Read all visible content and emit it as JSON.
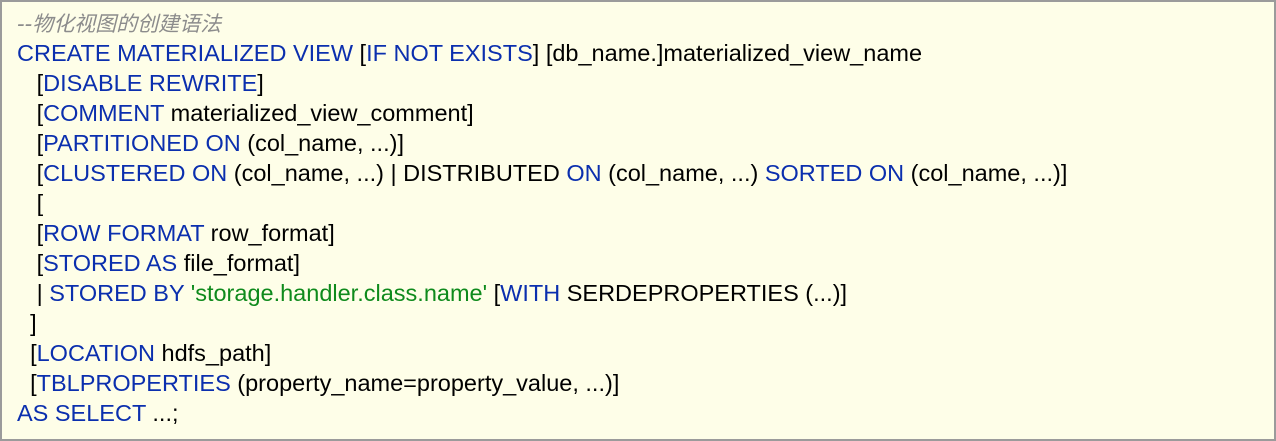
{
  "code_lines": [
    {
      "indent": "",
      "tokens": [
        {
          "t": "--物化视图的创建语法",
          "c": "cmt"
        }
      ]
    },
    {
      "indent": "",
      "tokens": [
        {
          "t": "CREATE MATERIALIZED VIEW ",
          "c": "kw"
        },
        {
          "t": "[",
          "c": "txt"
        },
        {
          "t": "IF NOT EXISTS",
          "c": "kw"
        },
        {
          "t": "] [db_name.]materialized_view_name",
          "c": "txt"
        }
      ]
    },
    {
      "indent": "   ",
      "tokens": [
        {
          "t": "[",
          "c": "txt"
        },
        {
          "t": "DISABLE REWRITE",
          "c": "kw"
        },
        {
          "t": "]",
          "c": "txt"
        }
      ]
    },
    {
      "indent": "   ",
      "tokens": [
        {
          "t": "[",
          "c": "txt"
        },
        {
          "t": "COMMENT",
          "c": "kw"
        },
        {
          "t": " materialized_view_comment]",
          "c": "txt"
        }
      ]
    },
    {
      "indent": "   ",
      "tokens": [
        {
          "t": "[",
          "c": "txt"
        },
        {
          "t": "PARTITIONED ON",
          "c": "kw"
        },
        {
          "t": " (col_name, ...)]",
          "c": "txt"
        }
      ]
    },
    {
      "indent": "   ",
      "tokens": [
        {
          "t": "[",
          "c": "txt"
        },
        {
          "t": "CLUSTERED ON",
          "c": "kw"
        },
        {
          "t": " (col_name, ...) | DISTRIBUTED ",
          "c": "txt"
        },
        {
          "t": "ON",
          "c": "kw"
        },
        {
          "t": " (col_name, ...) ",
          "c": "txt"
        },
        {
          "t": "SORTED ON",
          "c": "kw"
        },
        {
          "t": " (col_name, ...)]",
          "c": "txt"
        }
      ]
    },
    {
      "indent": "   ",
      "tokens": [
        {
          "t": "[",
          "c": "txt"
        }
      ]
    },
    {
      "indent": "   ",
      "tokens": [
        {
          "t": "[",
          "c": "txt"
        },
        {
          "t": "ROW FORMAT",
          "c": "kw"
        },
        {
          "t": " row_format]",
          "c": "txt"
        }
      ]
    },
    {
      "indent": "   ",
      "tokens": [
        {
          "t": "[",
          "c": "txt"
        },
        {
          "t": "STORED AS",
          "c": "kw"
        },
        {
          "t": " file_format]",
          "c": "txt"
        }
      ]
    },
    {
      "indent": "   ",
      "tokens": [
        {
          "t": "| ",
          "c": "txt"
        },
        {
          "t": "STORED BY",
          "c": "kw"
        },
        {
          "t": " ",
          "c": "txt"
        },
        {
          "t": "'storage.handler.class.name'",
          "c": "str"
        },
        {
          "t": " [",
          "c": "txt"
        },
        {
          "t": "WITH",
          "c": "kw"
        },
        {
          "t": " SERDEPROPERTIES (...)]",
          "c": "txt"
        }
      ]
    },
    {
      "indent": "  ",
      "tokens": [
        {
          "t": "]",
          "c": "txt"
        }
      ]
    },
    {
      "indent": "  ",
      "tokens": [
        {
          "t": "[",
          "c": "txt"
        },
        {
          "t": "LOCATION",
          "c": "kw"
        },
        {
          "t": " hdfs_path]",
          "c": "txt"
        }
      ]
    },
    {
      "indent": "  ",
      "tokens": [
        {
          "t": "[",
          "c": "txt"
        },
        {
          "t": "TBLPROPERTIES",
          "c": "kw"
        },
        {
          "t": " (property_name=property_value, ...)]",
          "c": "txt"
        }
      ]
    },
    {
      "indent": "",
      "tokens": [
        {
          "t": "AS SELECT",
          "c": "kw"
        },
        {
          "t": " ...;",
          "c": "txt"
        }
      ]
    }
  ]
}
